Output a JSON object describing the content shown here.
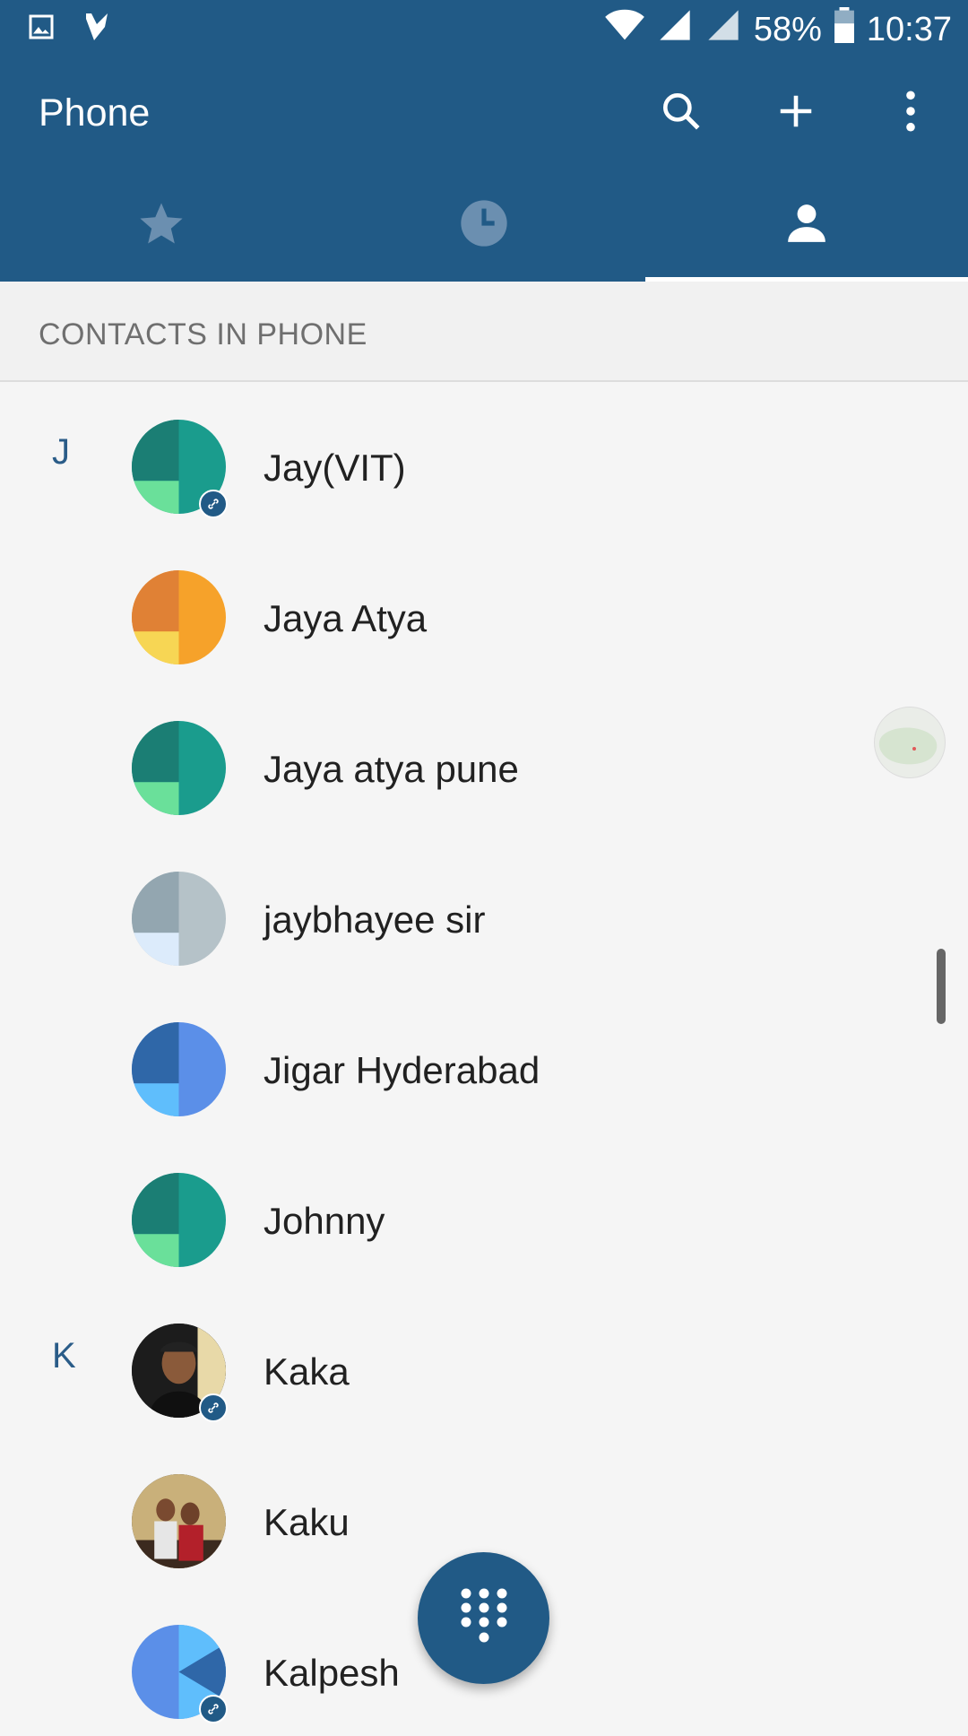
{
  "status_bar": {
    "battery": "58%",
    "time": "10:37",
    "icons": [
      "image-icon",
      "check-icon",
      "wifi-icon",
      "signal-icon",
      "signal-roaming-icon",
      "battery-icon"
    ]
  },
  "app_bar": {
    "title": "Phone",
    "actions": [
      "search-icon",
      "add-icon",
      "more-vert-icon"
    ]
  },
  "tabs": [
    {
      "icon": "star-icon",
      "selected": false
    },
    {
      "icon": "clock-icon",
      "selected": false
    },
    {
      "icon": "person-icon",
      "selected": true
    }
  ],
  "section": {
    "title": "CONTACTS IN PHONE"
  },
  "contacts": [
    {
      "letter": "J",
      "name": "Jay(VIT)",
      "avatar": "teal",
      "linked": true
    },
    {
      "letter": "",
      "name": "Jaya Atya",
      "avatar": "orange",
      "linked": false
    },
    {
      "letter": "",
      "name": "Jaya atya pune",
      "avatar": "teal",
      "linked": false
    },
    {
      "letter": "",
      "name": "jaybhayee sir",
      "avatar": "grey",
      "linked": false
    },
    {
      "letter": "",
      "name": "Jigar Hyderabad",
      "avatar": "blue",
      "linked": false
    },
    {
      "letter": "",
      "name": "Johnny",
      "avatar": "teal",
      "linked": false
    },
    {
      "letter": "K",
      "name": "Kaka",
      "avatar": "photo",
      "linked": true
    },
    {
      "letter": "",
      "name": "Kaku",
      "avatar": "photo",
      "linked": false
    },
    {
      "letter": "",
      "name": "Kalpesh",
      "avatar": "blue-alt",
      "linked": true
    }
  ],
  "colors": {
    "primary": "#215a86",
    "accent_text": "#2a5c88",
    "background": "#f5f5f5"
  },
  "fab": {
    "icon": "dialpad-icon"
  }
}
